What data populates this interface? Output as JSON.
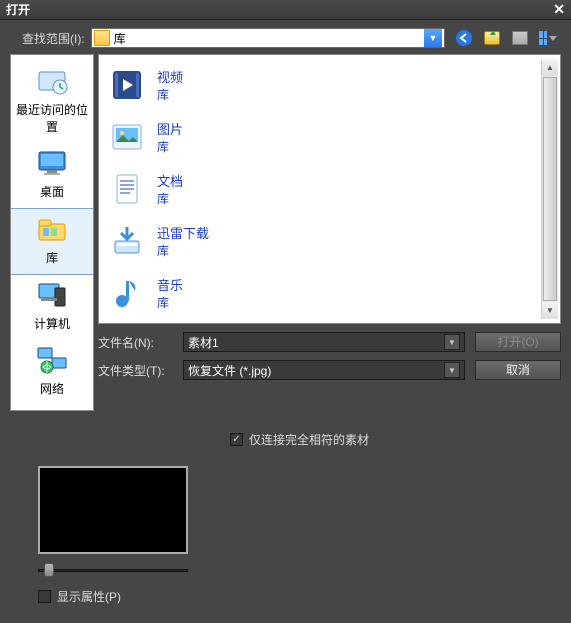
{
  "title": "打开",
  "toolbar": {
    "lookin_label": "查找范围(I):",
    "lookin_value": "库"
  },
  "places": [
    {
      "id": "recent",
      "label": "最近访问的位置"
    },
    {
      "id": "desktop",
      "label": "桌面"
    },
    {
      "id": "libraries",
      "label": "库"
    },
    {
      "id": "computer",
      "label": "计算机"
    },
    {
      "id": "network",
      "label": "网络"
    }
  ],
  "files": [
    {
      "name": "视频",
      "sub": "库",
      "icon": "video"
    },
    {
      "name": "图片",
      "sub": "库",
      "icon": "picture"
    },
    {
      "name": "文档",
      "sub": "库",
      "icon": "document"
    },
    {
      "name": "迅雷下载",
      "sub": "库",
      "icon": "download"
    },
    {
      "name": "音乐",
      "sub": "库",
      "icon": "music"
    }
  ],
  "fields": {
    "filename_label": "文件名(N):",
    "filename_value": "素材1",
    "filetype_label": "文件类型(T):",
    "filetype_value": "恢复文件 (*.jpg)"
  },
  "buttons": {
    "open": "打开(O)",
    "cancel": "取消"
  },
  "options": {
    "link_exact_checked": true,
    "link_exact_label": "仅连接完全相符的素材",
    "show_props_checked": false,
    "show_props_label": "显示属性(P)"
  }
}
